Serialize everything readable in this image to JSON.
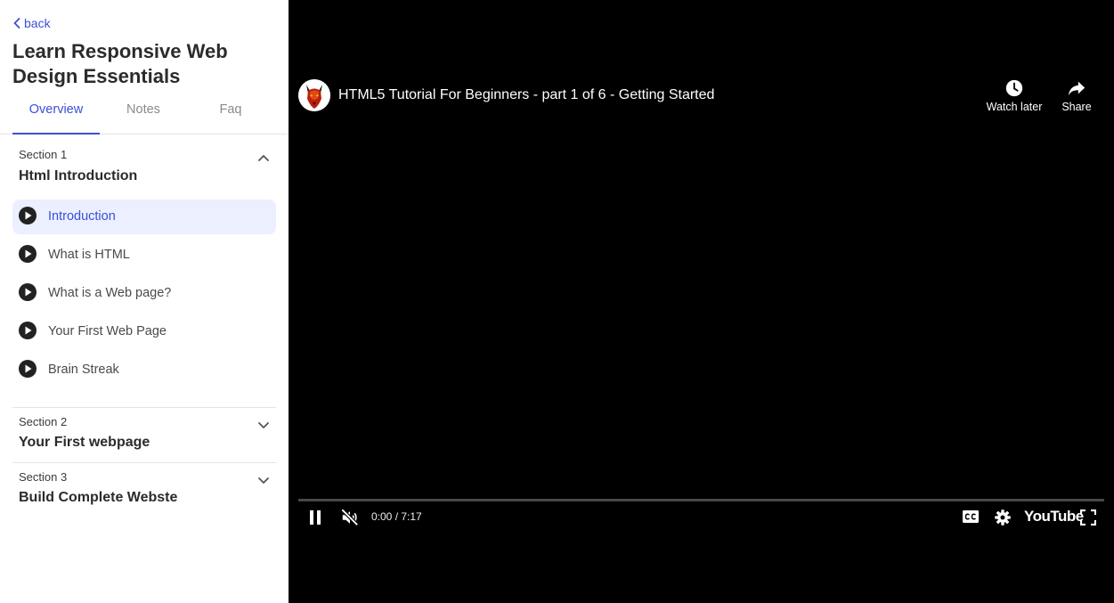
{
  "sidebar": {
    "back_label": "back",
    "course_title": "Learn Responsive Web Design Essentials",
    "tabs": [
      {
        "label": "Overview",
        "active": true
      },
      {
        "label": "Notes",
        "active": false
      },
      {
        "label": "Faq",
        "active": false
      }
    ],
    "sections": [
      {
        "number_label": "Section 1",
        "title": "Html Introduction",
        "expanded": true,
        "lessons": [
          {
            "label": "Introduction",
            "active": true
          },
          {
            "label": "What is HTML",
            "active": false
          },
          {
            "label": "What is a Web page?",
            "active": false
          },
          {
            "label": "Your First Web Page",
            "active": false
          },
          {
            "label": "Brain Streak",
            "active": false
          }
        ]
      },
      {
        "number_label": "Section 2",
        "title": "Your First webpage",
        "expanded": false
      },
      {
        "number_label": "Section 3",
        "title": "Build Complete Webste",
        "expanded": false
      }
    ]
  },
  "player": {
    "video_title": "HTML5 Tutorial For Beginners - part 1 of 6 - Getting Started",
    "watch_later_label": "Watch later",
    "share_label": "Share",
    "time_display": "0:00 / 7:17",
    "progress": 0,
    "logo_text": "YouTube",
    "state": "playing",
    "muted": true
  },
  "colors": {
    "accent": "#3b4fd8",
    "active_lesson_bg": "#ecefff",
    "player_bg": "#000000",
    "progress_played": "#ff0000"
  },
  "icons": {
    "back": "chevron-left-icon",
    "expand": "chevron-up-icon",
    "collapse": "chevron-down-icon",
    "lesson": "play-circle-icon",
    "watch_later": "clock-icon",
    "share": "share-arrow-icon",
    "pause": "pause-icon",
    "mute": "volume-muted-icon",
    "captions": "closed-captions-icon",
    "settings": "gear-icon",
    "fullscreen": "fullscreen-icon"
  }
}
